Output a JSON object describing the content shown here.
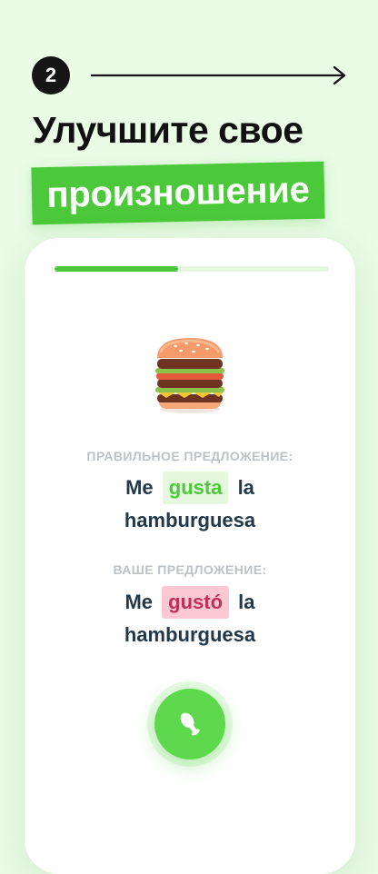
{
  "step": {
    "number": "2"
  },
  "headline": "Улучшите свое",
  "highlight": "произношение",
  "lesson": {
    "progress": 0.45,
    "image_icon": "hamburger-icon",
    "correct_label": "ПРАВИЛЬНОЕ ПРЕДЛОЖЕНИЕ:",
    "correct_sentence": {
      "line1": [
        "Me",
        "gusta",
        "la"
      ],
      "line2": "hamburguesa"
    },
    "yours_label": "ВАШЕ ПРЕДЛОЖЕНИЕ:",
    "your_sentence": {
      "line1": [
        "Me",
        "gustó",
        "la"
      ],
      "line2": "hamburguesa"
    },
    "mic_icon": "microphone-icon"
  },
  "colors": {
    "background": "#eafbe6",
    "accent": "#4cc93a",
    "correct_bg": "#e5f8de",
    "wrong_bg": "#fbc8d3",
    "wrong_text": "#c0305a",
    "sentence_text": "#23394a"
  }
}
